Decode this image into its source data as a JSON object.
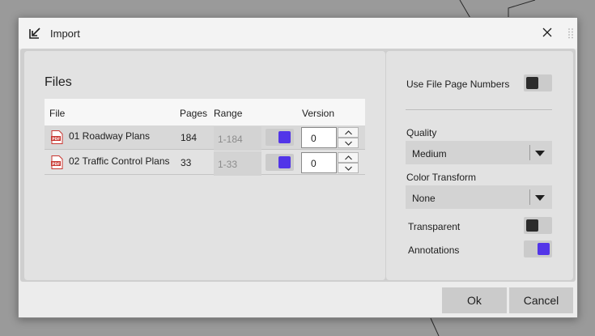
{
  "dialog": {
    "title": "Import"
  },
  "files": {
    "heading": "Files",
    "columns": [
      "File",
      "Pages",
      "Range",
      "Version"
    ],
    "rows": [
      {
        "name": "01 Roadway Plans",
        "pages": "184",
        "range": "1-184",
        "version": "0",
        "icon": "pdf-icon"
      },
      {
        "name": "02 Traffic Control Plans",
        "pages": "33",
        "range": "1-33",
        "version": "0",
        "icon": "pdf-icon"
      }
    ]
  },
  "options": {
    "use_file_page_numbers_label": "Use File Page Numbers",
    "use_file_page_numbers": false,
    "quality_label": "Quality",
    "quality_value": "Medium",
    "color_transform_label": "Color Transform",
    "color_transform_value": "None",
    "transparent_label": "Transparent",
    "transparent": false,
    "annotations_label": "Annotations",
    "annotations": true
  },
  "buttons": {
    "ok": "Ok",
    "cancel": "Cancel"
  },
  "colors": {
    "accent": "#5235e8",
    "toggle_off_knob": "#2c2c2c"
  }
}
